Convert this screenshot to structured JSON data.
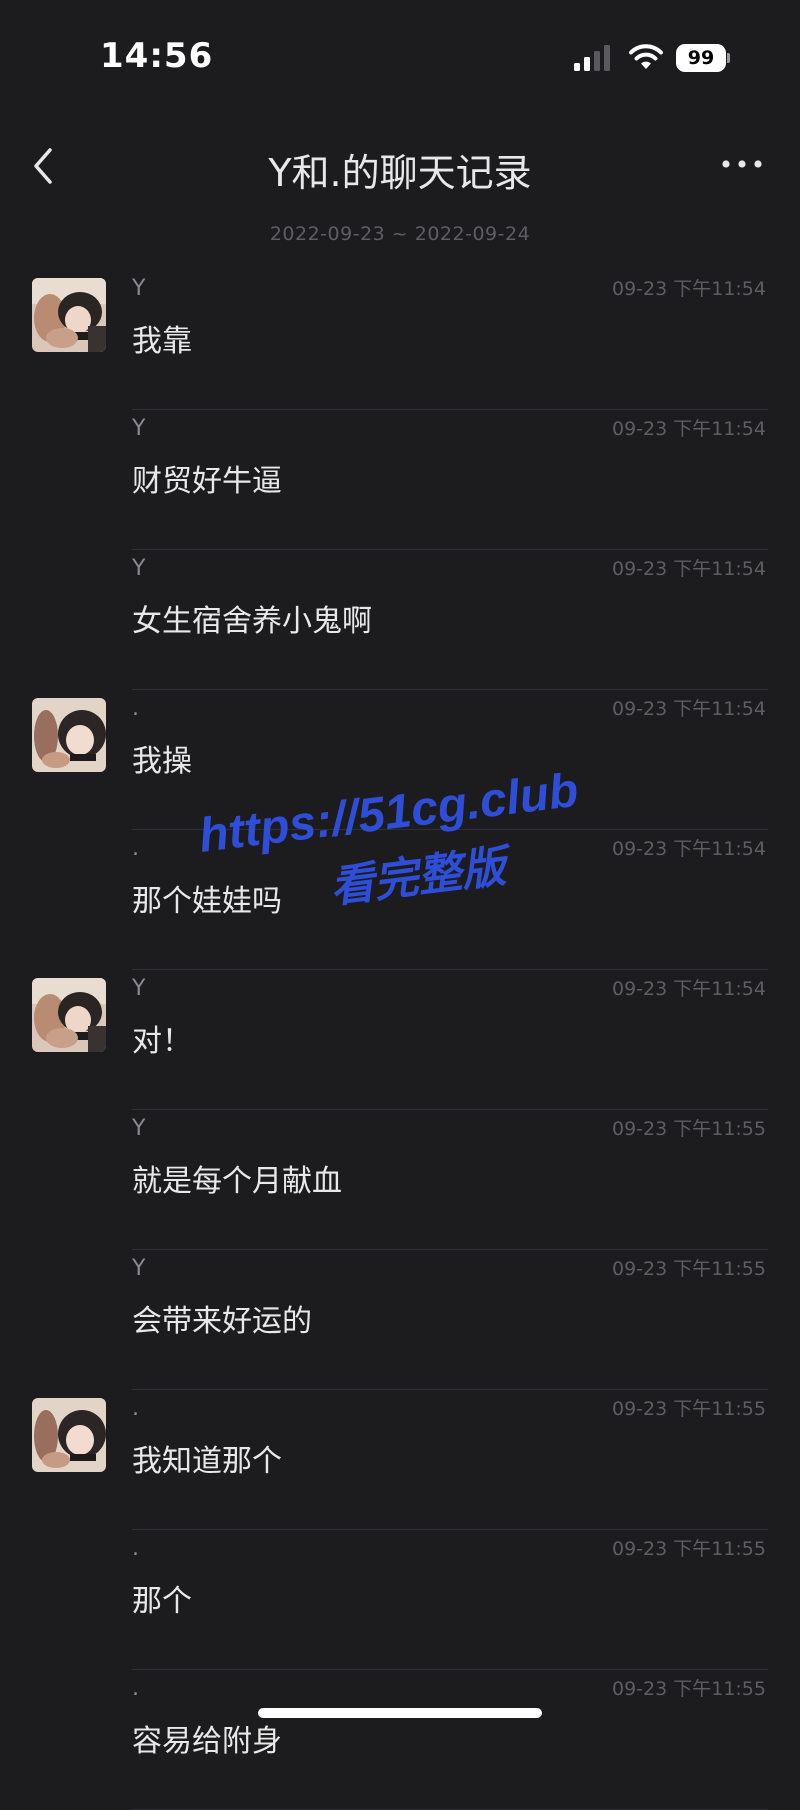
{
  "status_bar": {
    "time": "14:56",
    "battery_level": "99"
  },
  "header": {
    "title": "Y和.的聊天记录",
    "date_range": "2022-09-23 ~ 2022-09-24"
  },
  "messages": [
    {
      "sender": "Y",
      "time": "09-23 下午11:54",
      "text": "我靠",
      "show_avatar": true,
      "avatar": "avatar-y"
    },
    {
      "sender": "Y",
      "time": "09-23 下午11:54",
      "text": "财贸好牛逼",
      "show_avatar": false
    },
    {
      "sender": "Y",
      "time": "09-23 下午11:54",
      "text": "女生宿舍养小鬼啊",
      "show_avatar": false
    },
    {
      "sender": ".",
      "time": "09-23 下午11:54",
      "text": "我操",
      "show_avatar": true,
      "avatar": "avatar-dot"
    },
    {
      "sender": ".",
      "time": "09-23 下午11:54",
      "text": "那个娃娃吗",
      "show_avatar": false
    },
    {
      "sender": "Y",
      "time": "09-23 下午11:54",
      "text": "对！",
      "show_avatar": true,
      "avatar": "avatar-y"
    },
    {
      "sender": "Y",
      "time": "09-23 下午11:55",
      "text": "就是每个月献血",
      "show_avatar": false
    },
    {
      "sender": "Y",
      "time": "09-23 下午11:55",
      "text": "会带来好运的",
      "show_avatar": false
    },
    {
      "sender": ".",
      "time": "09-23 下午11:55",
      "text": "我知道那个",
      "show_avatar": true,
      "avatar": "avatar-dot"
    },
    {
      "sender": ".",
      "time": "09-23 下午11:55",
      "text": "那个",
      "show_avatar": false
    },
    {
      "sender": ".",
      "time": "09-23 下午11:55",
      "text": "容易给附身",
      "show_avatar": false
    }
  ],
  "watermark": {
    "url": "https://51cg.club",
    "subtitle": "看完整版"
  },
  "colors": {
    "background": "#1c1c1e",
    "watermark": "#2f4ed8"
  },
  "icons": [
    "signal-icon",
    "wifi-icon",
    "battery-icon",
    "back-icon",
    "more-icon"
  ]
}
